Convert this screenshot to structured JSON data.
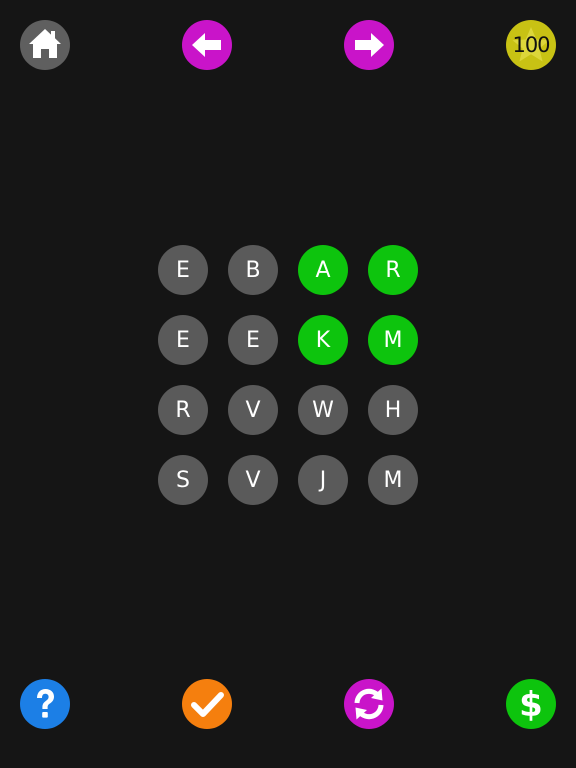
{
  "colors": {
    "background": "#151515",
    "tile_default": "#5a5a5a",
    "tile_selected": "#0dc40d",
    "home": "#5f5f5f",
    "nav_arrows": "#c914c9",
    "score_badge": "#c8c214",
    "score_star": "#dcd63a",
    "help": "#1c7fe6",
    "check": "#f57f0e",
    "shuffle": "#c914c9",
    "buy": "#0dc40d"
  },
  "top_bar": {
    "home_icon": "home-icon",
    "prev_icon": "arrow-left-icon",
    "next_icon": "arrow-right-icon",
    "score": "100",
    "score_icon": "star-icon"
  },
  "bottom_bar": {
    "help_icon": "question-icon",
    "check_icon": "checkmark-icon",
    "shuffle_icon": "refresh-icon",
    "buy_icon": "dollar-icon"
  },
  "grid": {
    "rows": [
      [
        {
          "letter": "E",
          "selected": false
        },
        {
          "letter": "B",
          "selected": false
        },
        {
          "letter": "A",
          "selected": true
        },
        {
          "letter": "R",
          "selected": true
        }
      ],
      [
        {
          "letter": "E",
          "selected": false
        },
        {
          "letter": "E",
          "selected": false
        },
        {
          "letter": "K",
          "selected": true
        },
        {
          "letter": "M",
          "selected": true
        }
      ],
      [
        {
          "letter": "R",
          "selected": false
        },
        {
          "letter": "V",
          "selected": false
        },
        {
          "letter": "W",
          "selected": false
        },
        {
          "letter": "H",
          "selected": false
        }
      ],
      [
        {
          "letter": "S",
          "selected": false
        },
        {
          "letter": "V",
          "selected": false
        },
        {
          "letter": "J",
          "selected": false
        },
        {
          "letter": "M",
          "selected": false
        }
      ]
    ]
  }
}
